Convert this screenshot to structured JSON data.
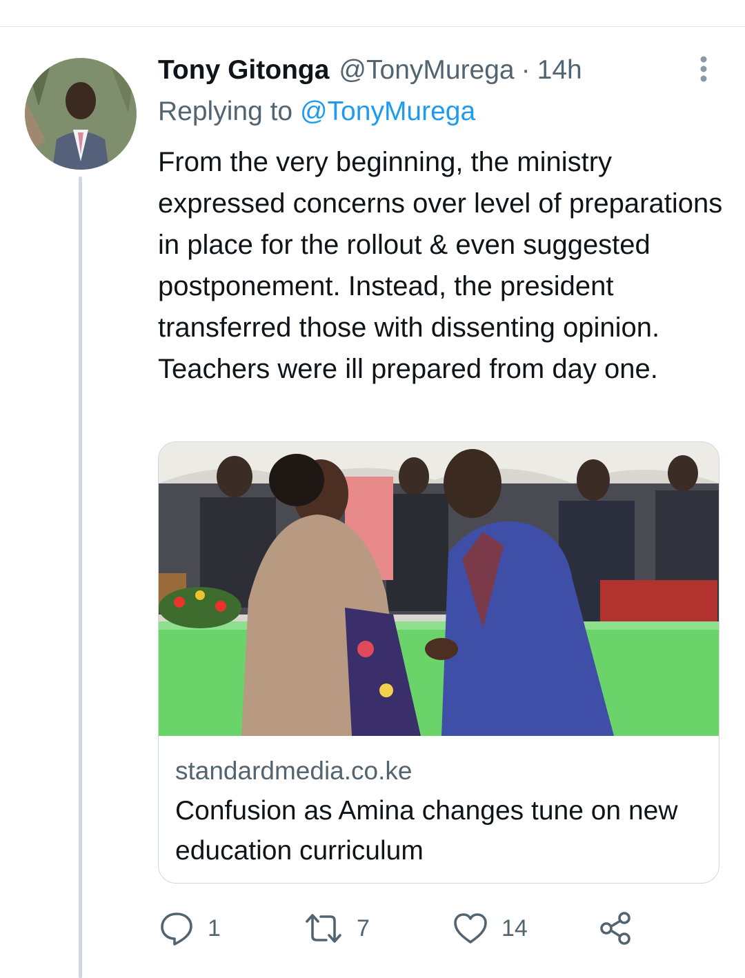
{
  "tweet": {
    "author_name": "Tony Gitonga",
    "author_handle": "@TonyMurega",
    "separator": "·",
    "time": "14h",
    "replying_prefix": "Replying to",
    "replying_to": "@TonyMurega",
    "text": "From the very beginning, the ministry expressed concerns over level of preparations in place for the rollout & even suggested postponement. Instead, the president transferred those with dissenting opinion.\nTeachers were ill prepared from day one."
  },
  "card": {
    "domain": "standardmedia.co.ke",
    "title": "Confusion as Amina changes tune on new education curriculum"
  },
  "actions": {
    "replies": "1",
    "retweets": "7",
    "likes": "14"
  },
  "icons": {
    "more": "more-vertical-icon",
    "reply": "reply-icon",
    "retweet": "retweet-icon",
    "like": "heart-icon",
    "share": "share-icon"
  },
  "colors": {
    "accent": "#1d9bf0",
    "secondary_text": "#536471",
    "divider": "#cfd9de"
  }
}
